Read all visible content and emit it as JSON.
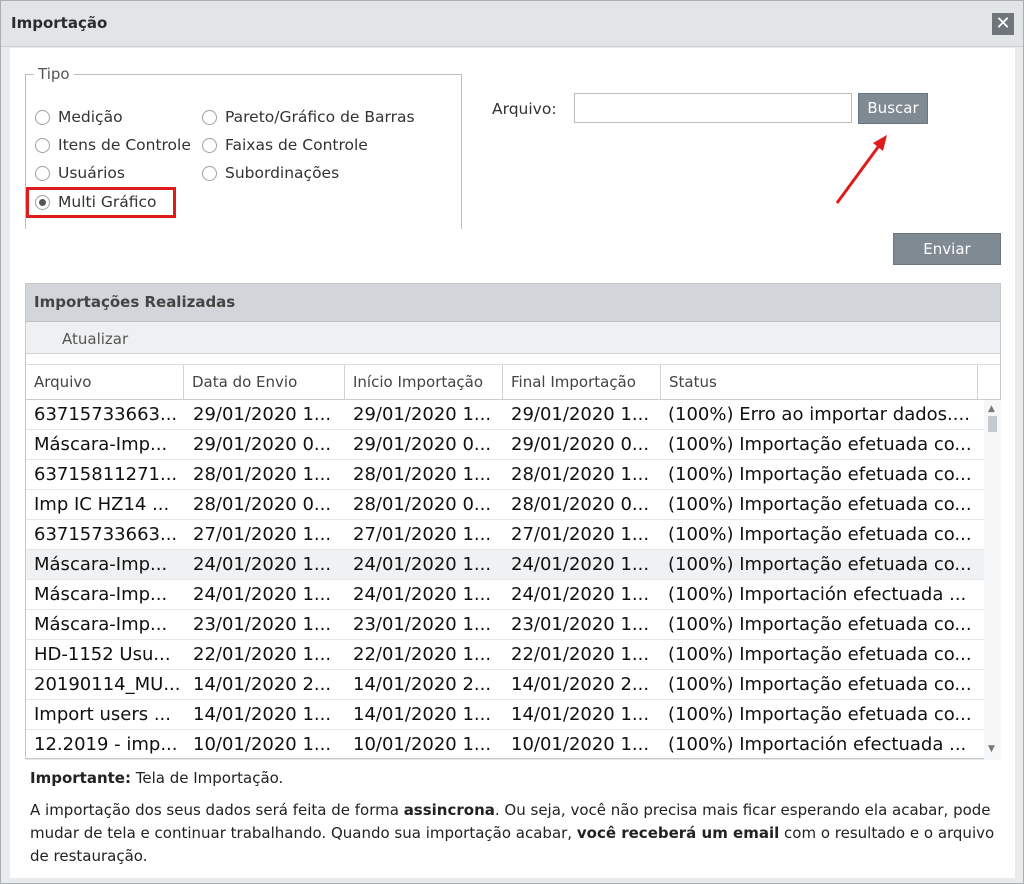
{
  "window": {
    "title": "Importação"
  },
  "tipo": {
    "legend": "Tipo",
    "options": {
      "medicao": "Medição",
      "itens_controle": "Itens de Controle",
      "usuarios": "Usuários",
      "multi_grafico": "Multi Gráfico",
      "pareto": "Pareto/Gráfico de Barras",
      "faixas": "Faixas de Controle",
      "subordinacoes": "Subordinações"
    },
    "selected": "Multi Gráfico"
  },
  "arquivo": {
    "label": "Arquivo:",
    "value": "",
    "buscar_label": "Buscar"
  },
  "enviar_label": "Enviar",
  "importacoes": {
    "title": "Importações Realizadas",
    "refresh_label": "Atualizar",
    "columns": [
      "Arquivo",
      "Data do Envio",
      "Início Importação",
      "Final Importação",
      "Status"
    ],
    "rows": [
      [
        "63715733663...",
        "29/01/2020 1...",
        "29/01/2020 1...",
        "29/01/2020 1...",
        "(100%) Erro ao importar dados...."
      ],
      [
        "Máscara-Imp...",
        "29/01/2020 0...",
        "29/01/2020 0...",
        "29/01/2020 0...",
        "(100%) Importação efetuada co..."
      ],
      [
        "63715811271...",
        "28/01/2020 1...",
        "28/01/2020 1...",
        "28/01/2020 1...",
        "(100%) Importação efetuada co..."
      ],
      [
        "Imp IC HZ14 ...",
        "28/01/2020 0...",
        "28/01/2020 0...",
        "28/01/2020 0...",
        "(100%) Importação efetuada co..."
      ],
      [
        "63715733663...",
        "27/01/2020 1...",
        "27/01/2020 1...",
        "27/01/2020 1...",
        "(100%) Importação efetuada co..."
      ],
      [
        "Máscara-Imp...",
        "24/01/2020 1...",
        "24/01/2020 1...",
        "24/01/2020 1...",
        "(100%) Importação efetuada co..."
      ],
      [
        "Máscara-Imp...",
        "24/01/2020 1...",
        "24/01/2020 1...",
        "24/01/2020 1...",
        "(100%) Importación efectuada ..."
      ],
      [
        "Máscara-Imp...",
        "23/01/2020 1...",
        "23/01/2020 1...",
        "23/01/2020 1...",
        "(100%) Importação efetuada co..."
      ],
      [
        "HD-1152 Usu...",
        "22/01/2020 1...",
        "22/01/2020 1...",
        "22/01/2020 1...",
        "(100%) Importação efetuada co..."
      ],
      [
        "20190114_MU...",
        "14/01/2020 2...",
        "14/01/2020 2...",
        "14/01/2020 2...",
        "(100%) Importação efetuada co..."
      ],
      [
        "Import users ...",
        "14/01/2020 1...",
        "14/01/2020 1...",
        "14/01/2020 1...",
        "(100%) Importação efetuada co..."
      ],
      [
        "12.2019 - imp...",
        "10/01/2020 1...",
        "10/01/2020 1...",
        "10/01/2020 1...",
        "(100%) Importación efectuada ..."
      ]
    ]
  },
  "footer": {
    "note_bold": "Importante:",
    "note_text": " Tela de Importação.",
    "p1": "A importação dos seus dados será feita de forma ",
    "p1_bold": "assincrona",
    "p2": ". Ou seja, você não precisa mais ficar esperando ela acabar, pode mudar de tela e continuar trabalhando. Quando sua importação acabar, ",
    "p2_bold": "você receberá um email",
    "p3": " com o resultado e o arquivo de restauração."
  },
  "colors": {
    "highlight": "#e01b1b",
    "button": "#7f8a93",
    "header": "#d2d6da"
  }
}
